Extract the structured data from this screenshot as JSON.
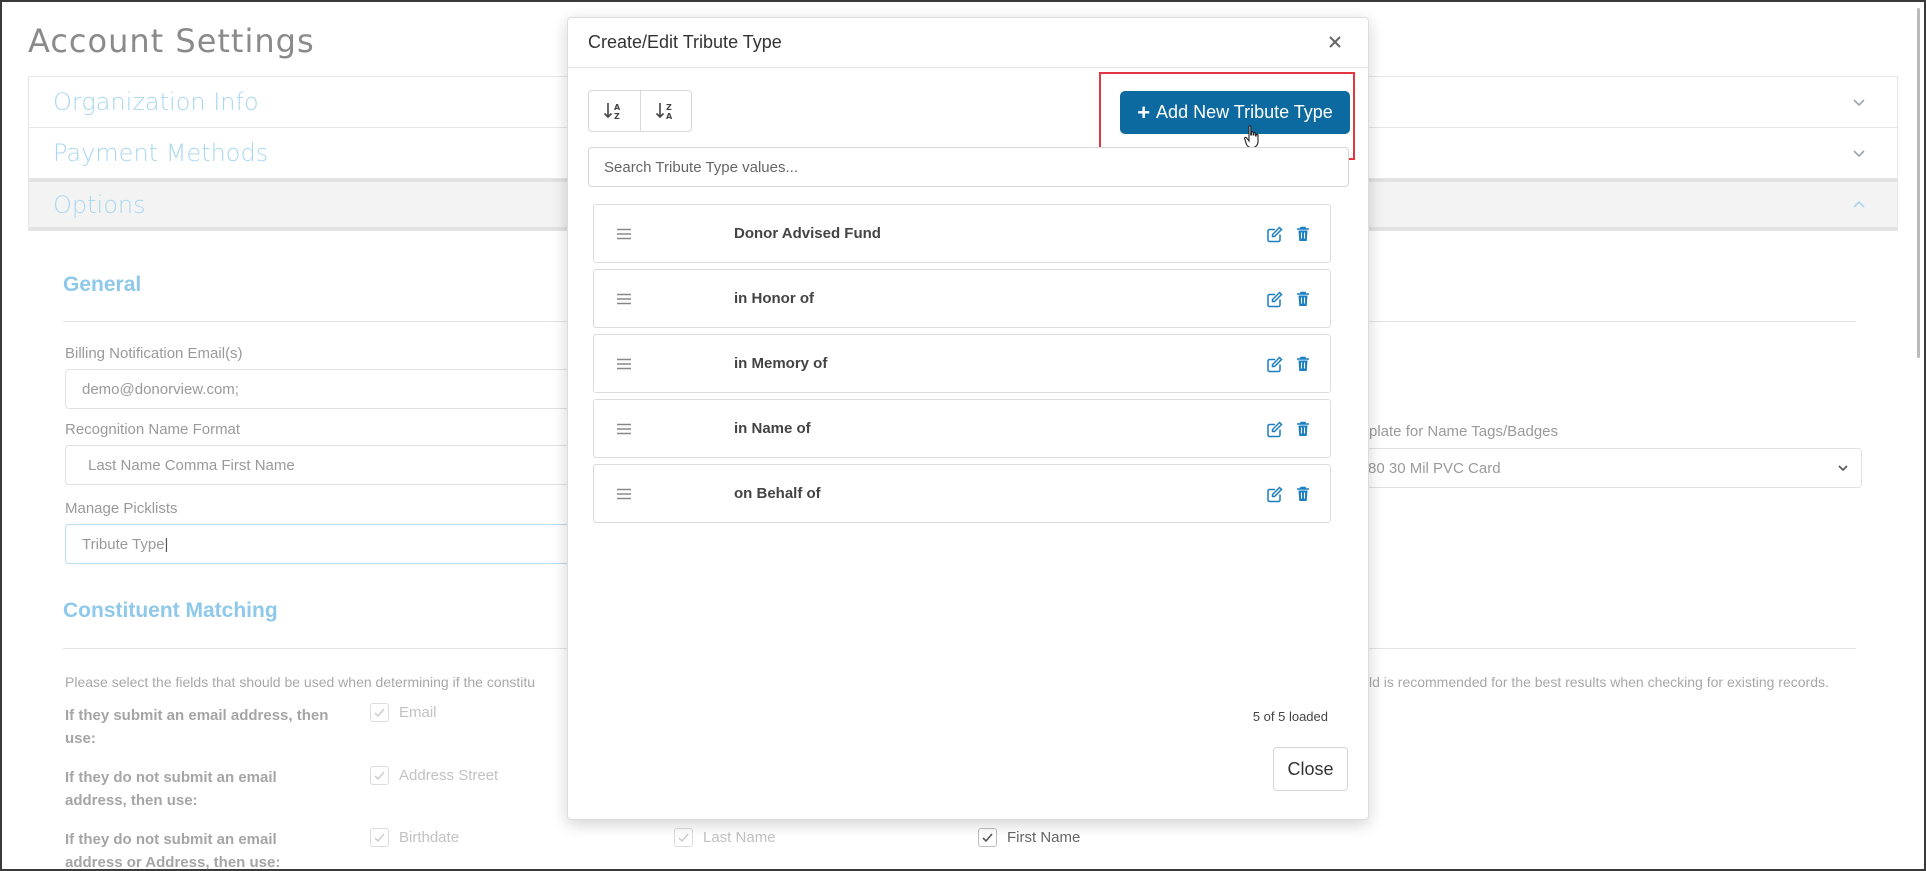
{
  "page": {
    "title": "Account Settings",
    "accordion": [
      {
        "label": "Organization Info"
      },
      {
        "label": "Payment Methods"
      },
      {
        "label": "Options"
      }
    ],
    "general": {
      "title": "General",
      "billing_label": "Billing Notification Email(s)",
      "billing_value": "demo@donorview.com;",
      "recognition_label": "Recognition Name Format",
      "recognition_value": "Last Name Comma First Name",
      "template_label": "plate for Name Tags/Badges",
      "template_value": "80 30 Mil PVC Card",
      "picklists_label": "Manage Picklists",
      "picklists_value": "Tribute Type"
    },
    "constituent": {
      "title": "Constituent Matching",
      "help_left": "Please select the fields that should be used when determining if the constitu",
      "help_right": "ld is recommended for the best results when checking for existing records.",
      "rule1_label_a": "If they submit an email address, then",
      "rule1_label_b": "use:",
      "rule1_checkbox": "Email",
      "rule2_label_a": "If they do not submit an email",
      "rule2_label_b": "address, then use:",
      "rule2_checkbox": "Address Street",
      "rule3_label_a": "If they do not submit an email",
      "rule3_label_b": "address or Address, then use:",
      "rule3_checkbox_1": "Birthdate",
      "rule3_checkbox_2": "Last Name",
      "rule3_checkbox_3": "First Name"
    }
  },
  "modal": {
    "title": "Create/Edit Tribute Type",
    "add_button_label": "Add New Tribute Type",
    "search_placeholder": "Search Tribute Type values...",
    "items": [
      {
        "label": "Donor Advised Fund"
      },
      {
        "label": "in Honor of"
      },
      {
        "label": "in Memory of"
      },
      {
        "label": "in Name of"
      },
      {
        "label": "on Behalf of"
      }
    ],
    "loaded_status": "5 of 5 loaded",
    "close_label": "Close"
  },
  "colors": {
    "primary": "#0d6aa0",
    "icon_blue": "#1a7fc1",
    "highlight": "#e0383e",
    "faded_title": "#a9d7ef"
  },
  "icons": {
    "sort_asc": "sort-alpha-down-icon",
    "sort_desc": "sort-alpha-up-icon",
    "edit": "pencil-square-icon",
    "delete": "trash-icon",
    "drag": "drag-handle-icon",
    "close": "close-icon"
  }
}
